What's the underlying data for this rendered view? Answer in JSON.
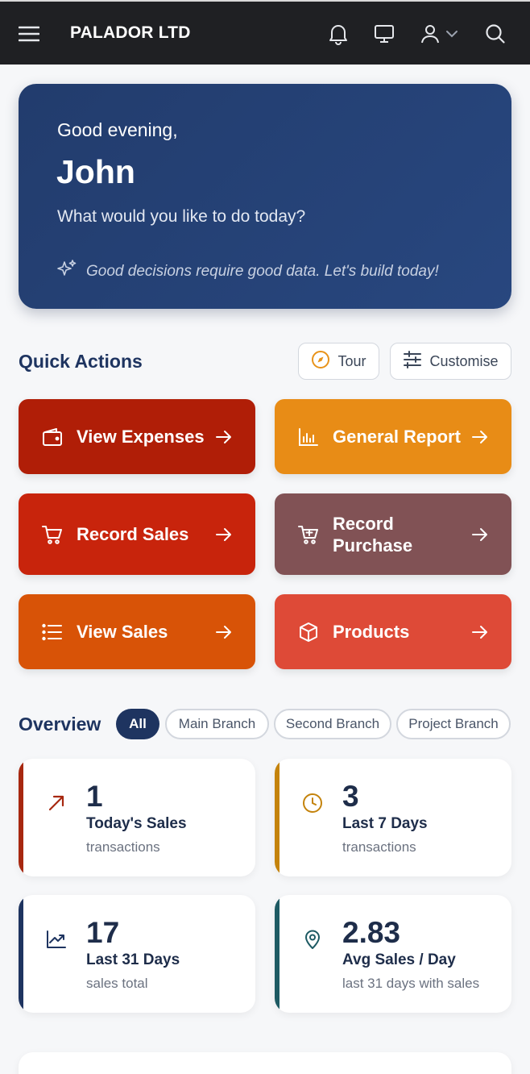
{
  "header": {
    "brand": "PALADOR LTD",
    "icons": [
      "menu-icon",
      "bell-icon",
      "monitor-icon",
      "user-icon",
      "chevron-down-icon",
      "search-icon"
    ]
  },
  "hero": {
    "greeting": "Good evening,",
    "name": "John",
    "question": "What would you like to do today?",
    "tip": "Good decisions require good data. Let's build today!"
  },
  "quick_actions": {
    "title": "Quick Actions",
    "tour_label": "Tour",
    "customise_label": "Customise",
    "items": [
      {
        "label": "View Expenses",
        "icon": "wallet-icon",
        "color": "#b01e07"
      },
      {
        "label": "General Report",
        "icon": "bar-chart-icon",
        "color": "#e88c16"
      },
      {
        "label": "Record Sales",
        "icon": "cart-icon",
        "color": "#c8240c"
      },
      {
        "label": "Record\nPurchase",
        "icon": "cart-plus-icon",
        "color": "#815255"
      },
      {
        "label": "View Sales",
        "icon": "list-icon",
        "color": "#d85307"
      },
      {
        "label": "Products",
        "icon": "box-icon",
        "color": "#de4a37"
      }
    ]
  },
  "overview": {
    "title": "Overview",
    "filters": [
      {
        "label": "All",
        "active": true
      },
      {
        "label": "Main Branch",
        "active": false
      },
      {
        "label": "Second Branch",
        "active": false
      },
      {
        "label": "Project Branch",
        "active": false
      }
    ],
    "stats": [
      {
        "value": "1",
        "label": "Today's Sales",
        "sub": "transactions",
        "icon": "trend-arrow-icon",
        "color": "#a72810"
      },
      {
        "value": "3",
        "label": "Last 7 Days",
        "sub": "transactions",
        "icon": "clock-icon",
        "color": "#c4830c"
      },
      {
        "value": "17",
        "label": "Last 31 Days",
        "sub": "sales total",
        "icon": "line-chart-icon",
        "color": "#1e3460"
      },
      {
        "value": "2.83",
        "label": "Avg Sales / Day",
        "sub": "last 31 days with sales",
        "icon": "map-pin-icon",
        "color": "#1d5a63"
      }
    ]
  }
}
